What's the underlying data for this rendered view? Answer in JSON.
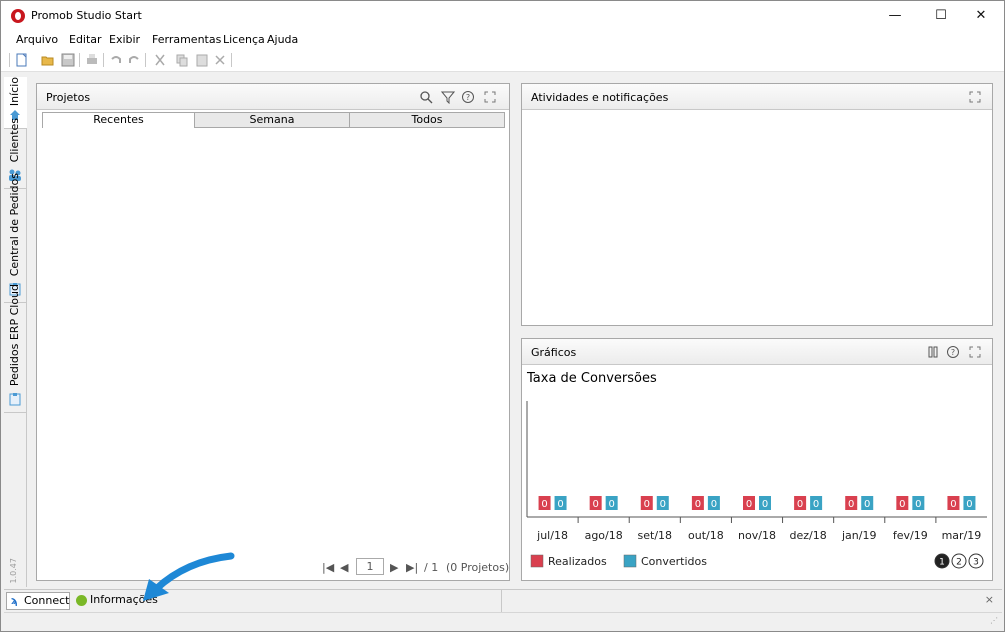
{
  "window": {
    "title": "Promob Studio Start",
    "controls": {
      "minimize": "—",
      "maximize": "☐",
      "close": "✕"
    }
  },
  "menu": [
    "Arquivo",
    "Editar",
    "Exibir",
    "Ferramentas",
    "Licença",
    "Ajuda"
  ],
  "sidebar": {
    "tabs": [
      {
        "label": "Início",
        "icon": "home-icon"
      },
      {
        "label": "Clientes",
        "icon": "clients-icon"
      },
      {
        "label": "Central de Pedidos",
        "icon": "orders-icon"
      },
      {
        "label": "Pedidos ERP Cloud",
        "icon": "cloud-orders-icon"
      }
    ],
    "version": "1.0.47"
  },
  "projects": {
    "title": "Projetos",
    "tabs": [
      "Recentes",
      "Semana",
      "Todos"
    ],
    "active_tab": "Recentes",
    "pager": {
      "page": "1",
      "total": "/ 1",
      "count": "(0 Projetos)"
    }
  },
  "activities": {
    "title": "Atividades e notificações"
  },
  "charts": {
    "title": "Gráficos",
    "pages": [
      "1",
      "2",
      "3"
    ],
    "active_page": "1"
  },
  "chart_data": {
    "type": "bar",
    "title": "Taxa de Conversões",
    "categories": [
      "jul/18",
      "ago/18",
      "set/18",
      "out/18",
      "nov/18",
      "dez/18",
      "jan/19",
      "fev/19",
      "mar/19"
    ],
    "series": [
      {
        "name": "Realizados",
        "values": [
          0,
          0,
          0,
          0,
          0,
          0,
          0,
          0,
          0
        ],
        "color": "#d9404f"
      },
      {
        "name": "Convertidos",
        "values": [
          0,
          0,
          0,
          0,
          0,
          0,
          0,
          0,
          0
        ],
        "color": "#3aa3c4"
      }
    ],
    "legend": "bottom-left"
  },
  "status": {
    "connect": "Connect",
    "info": "Informações",
    "close": "×",
    "arrow_color": "#1e88d6"
  }
}
